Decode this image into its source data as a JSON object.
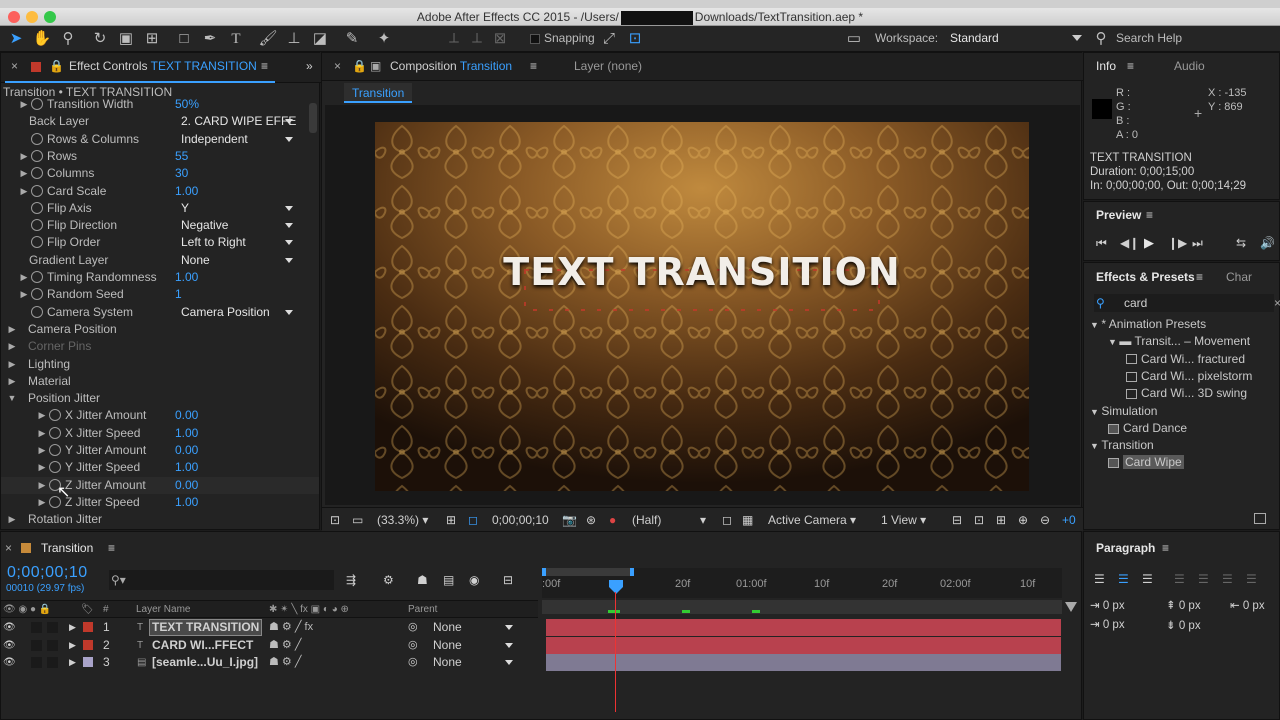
{
  "titlebar": {
    "title_left": "Adobe After Effects CC 2015 - /Users/",
    "title_right": "Downloads/TextTransition.aep *"
  },
  "toolbar": {
    "snapping": "Snapping",
    "workspace_label": "Workspace:",
    "workspace_value": "Standard",
    "search_help": "Search Help"
  },
  "effect_controls": {
    "tab_label": "Effect Controls",
    "tab_comp": "TEXT TRANSITION",
    "breadcrumb": "Transition • TEXT TRANSITION",
    "rows": [
      {
        "name": "Transition Width",
        "value": "50%",
        "indent": 1,
        "sw": true,
        "tri": true
      },
      {
        "name": "Back Layer",
        "value": "2. CARD WIPE EFFE",
        "indent": 1,
        "sw": false,
        "tri": false,
        "dropdown": true
      },
      {
        "name": "Rows & Columns",
        "value": "Independent",
        "indent": 1,
        "sw": true,
        "tri": false,
        "dropdown": true
      },
      {
        "name": "Rows",
        "value": "55",
        "indent": 1,
        "sw": true,
        "tri": true
      },
      {
        "name": "Columns",
        "value": "30",
        "indent": 1,
        "sw": true,
        "tri": true
      },
      {
        "name": "Card Scale",
        "value": "1.00",
        "indent": 1,
        "sw": true,
        "tri": true
      },
      {
        "name": "Flip Axis",
        "value": "Y",
        "indent": 1,
        "sw": true,
        "tri": false,
        "dropdown": true
      },
      {
        "name": "Flip Direction",
        "value": "Negative",
        "indent": 1,
        "sw": true,
        "tri": false,
        "dropdown": true
      },
      {
        "name": "Flip Order",
        "value": "Left to Right",
        "indent": 1,
        "sw": true,
        "tri": false,
        "dropdown": true
      },
      {
        "name": "Gradient Layer",
        "value": "None",
        "indent": 1,
        "sw": false,
        "tri": false,
        "dropdown": true
      },
      {
        "name": "Timing Randomness",
        "value": "1.00",
        "indent": 1,
        "sw": true,
        "tri": true
      },
      {
        "name": "Random Seed",
        "value": "1",
        "indent": 1,
        "sw": true,
        "tri": true
      },
      {
        "name": "Camera System",
        "value": "Camera Position",
        "indent": 1,
        "sw": true,
        "tri": false,
        "dropdown": true
      },
      {
        "name": "Camera Position",
        "value": "",
        "indent": 0,
        "sw": false,
        "tri": true
      },
      {
        "name": "Corner Pins",
        "value": "",
        "indent": 0,
        "sw": false,
        "tri": true,
        "dim": true
      },
      {
        "name": "Lighting",
        "value": "",
        "indent": 0,
        "sw": false,
        "tri": true
      },
      {
        "name": "Material",
        "value": "",
        "indent": 0,
        "sw": false,
        "tri": true
      },
      {
        "name": "Position Jitter",
        "value": "",
        "indent": 0,
        "sw": false,
        "tri": true,
        "open": true
      },
      {
        "name": "X Jitter Amount",
        "value": "0.00",
        "indent": 2,
        "sw": true,
        "tri": true
      },
      {
        "name": "X Jitter Speed",
        "value": "1.00",
        "indent": 2,
        "sw": true,
        "tri": true
      },
      {
        "name": "Y Jitter Amount",
        "value": "0.00",
        "indent": 2,
        "sw": true,
        "tri": true
      },
      {
        "name": "Y Jitter Speed",
        "value": "1.00",
        "indent": 2,
        "sw": true,
        "tri": true
      },
      {
        "name": "Z Jitter Amount",
        "value": "0.00",
        "indent": 2,
        "sw": true,
        "tri": true
      },
      {
        "name": "Z Jitter Speed",
        "value": "1.00",
        "indent": 2,
        "sw": true,
        "tri": true
      },
      {
        "name": "Rotation Jitter",
        "value": "",
        "indent": 0,
        "sw": false,
        "tri": true
      }
    ]
  },
  "composition": {
    "tab_label": "Composition",
    "tab_comp": "Transition",
    "layer_tab": "Layer (none)",
    "comp_chip": "Transition",
    "viewer_text": "TEXT TRANSITION",
    "bottom": {
      "zoom": "(33.3%)",
      "timecode": "0;00;00;10",
      "resolution": "(Half)",
      "camera": "Active Camera",
      "views": "1 View",
      "offset": "+0"
    }
  },
  "info": {
    "tab": "Info",
    "audio_tab": "Audio",
    "r": "R :",
    "g": "G :",
    "b": "B :",
    "a": "A : 0",
    "x": "X : -135",
    "y": "Y : 869",
    "layer_name": "TEXT TRANSITION",
    "duration": "Duration: 0;00;15;00",
    "inout": "In: 0;00;00;00, Out: 0;00;14;29"
  },
  "preview": {
    "title": "Preview"
  },
  "effects": {
    "tab": "Effects & Presets",
    "char_tab": "Char",
    "search": "card",
    "items": [
      {
        "label": "* Animation Presets",
        "level": 0,
        "tri": "▼"
      },
      {
        "label": "Transit... – Movement",
        "level": 1,
        "tri": "▼",
        "folder": true
      },
      {
        "label": "Card Wi... fractured",
        "level": 2
      },
      {
        "label": "Card Wi... pixelstorm",
        "level": 2
      },
      {
        "label": "Card Wi... 3D swing",
        "level": 2
      },
      {
        "label": "Simulation",
        "level": 0,
        "tri": "▼"
      },
      {
        "label": "Card Dance",
        "level": 1,
        "fx": true
      },
      {
        "label": "Transition",
        "level": 0,
        "tri": "▼"
      },
      {
        "label": "Card Wipe",
        "level": 1,
        "fx": true,
        "selected": true
      }
    ]
  },
  "paragraph": {
    "title": "Paragraph",
    "v1": "0 px",
    "v2": "0 px",
    "v3": "0 px",
    "v4": "0 px",
    "v5": "0 px"
  },
  "timeline": {
    "tab": "Transition",
    "timecode": "0;00;00;10",
    "fps": "00010 (29.97 fps)",
    "col_layer": "Layer Name",
    "col_hash": "#",
    "col_parent": "Parent",
    "ruler": [
      ":00f",
      "20f",
      "01:00f",
      "10f",
      "20f",
      "02:00f",
      "10f"
    ],
    "layers": [
      {
        "num": "1",
        "name": "TEXT TRANSITION",
        "parent": "None",
        "color": "#c0392b",
        "type": "T",
        "selected": true
      },
      {
        "num": "2",
        "name": "CARD WI...FFECT",
        "parent": "None",
        "color": "#c0392b",
        "type": "T"
      },
      {
        "num": "3",
        "name": "[seamle...Uu_I.jpg]",
        "parent": "None",
        "color": "#a9a3c9",
        "type": "img"
      }
    ]
  },
  "colors": {
    "accent": "#3aa0ff",
    "track_red": "#b8414e",
    "track_purple": "#7f7a93"
  }
}
